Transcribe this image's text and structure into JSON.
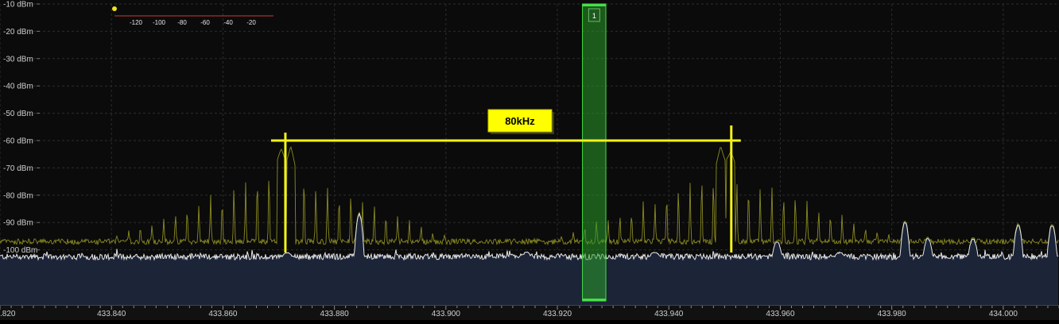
{
  "colors": {
    "background": "#0b0b0b",
    "grid": "#2c2c2c",
    "axis_text": "#cfcfcf",
    "spectrum_fill": "#1c2438",
    "live_trace": "#e8e8ea",
    "peak_trace": "#8a8a22",
    "marker": "#f2f21a",
    "channel_fill": "#2a9c2a",
    "channel_edge": "#46e046",
    "label_box": "#ffff00",
    "label_text": "#000000",
    "scale_line": "#c83a3a",
    "scale_dot": "#f2e21a"
  },
  "chart_data": {
    "type": "line",
    "title": "",
    "xlabel": "",
    "ylabel": "",
    "xlim": [
      433.82,
      434.01
    ],
    "ylim": [
      -117,
      -10
    ],
    "x_ticks": [
      433.82,
      433.84,
      433.86,
      433.88,
      433.9,
      433.92,
      433.94,
      433.96,
      433.98,
      434.0
    ],
    "x_tick_labels": [
      ".820",
      "433.840",
      "433.860",
      "433.880",
      "433.900",
      "433.920",
      "433.940",
      "433.960",
      "433.980",
      "434.000"
    ],
    "y_ticks": [
      -10,
      -20,
      -30,
      -40,
      -50,
      -60,
      -70,
      -80,
      -90,
      -100,
      -110
    ],
    "y_tick_labels": [
      "-10 dBm",
      "-20 dBm",
      "-30 dBm",
      "-40 dBm",
      "-50 dBm",
      "-60 dBm",
      "-70 dBm",
      "-80 dBm",
      "-90 dBm",
      "-100 dBm",
      "-110 dBm"
    ],
    "grid": true,
    "series": [
      {
        "role": "live",
        "color": "#e8e8ea",
        "noise_floor_dbm": -102.5,
        "spikes": [
          [
            433.8845,
            -87
          ],
          [
            433.9595,
            -97
          ],
          [
            433.9708,
            -101
          ],
          [
            433.9825,
            -90
          ],
          [
            433.9866,
            -96
          ],
          [
            433.9947,
            -96
          ],
          [
            434.0028,
            -91
          ],
          [
            434.0089,
            -91
          ],
          [
            433.8716,
            -101
          ],
          [
            433.9145,
            -101
          ],
          [
            433.9375,
            -101
          ]
        ]
      },
      {
        "role": "peak-hold",
        "color": "#8a8a22",
        "envelope_centers": [
          433.8705,
          433.9505
        ],
        "envelope_peak_dbm": -67,
        "envelope_floor_dbm": -97,
        "envelope_halfwidth_mhz": 0.032,
        "spike_spacing_mhz": 0.0021,
        "strong_peaks": [
          [
            433.8705,
            -63
          ],
          [
            433.8722,
            -62
          ],
          [
            433.9494,
            -62
          ],
          [
            433.9512,
            -64
          ]
        ]
      }
    ],
    "annotations": {
      "bandwidth_marker": {
        "label": "80kHz",
        "x_start": 433.8712,
        "x_end": 433.9512,
        "level_dbm": -60
      },
      "channel": {
        "label": "1",
        "x_start": 433.9245,
        "x_end": 433.9287
      },
      "level_scale": {
        "ticks": [
          "-120",
          "-100",
          "-80",
          "-60",
          "-40",
          "-20"
        ]
      }
    }
  }
}
